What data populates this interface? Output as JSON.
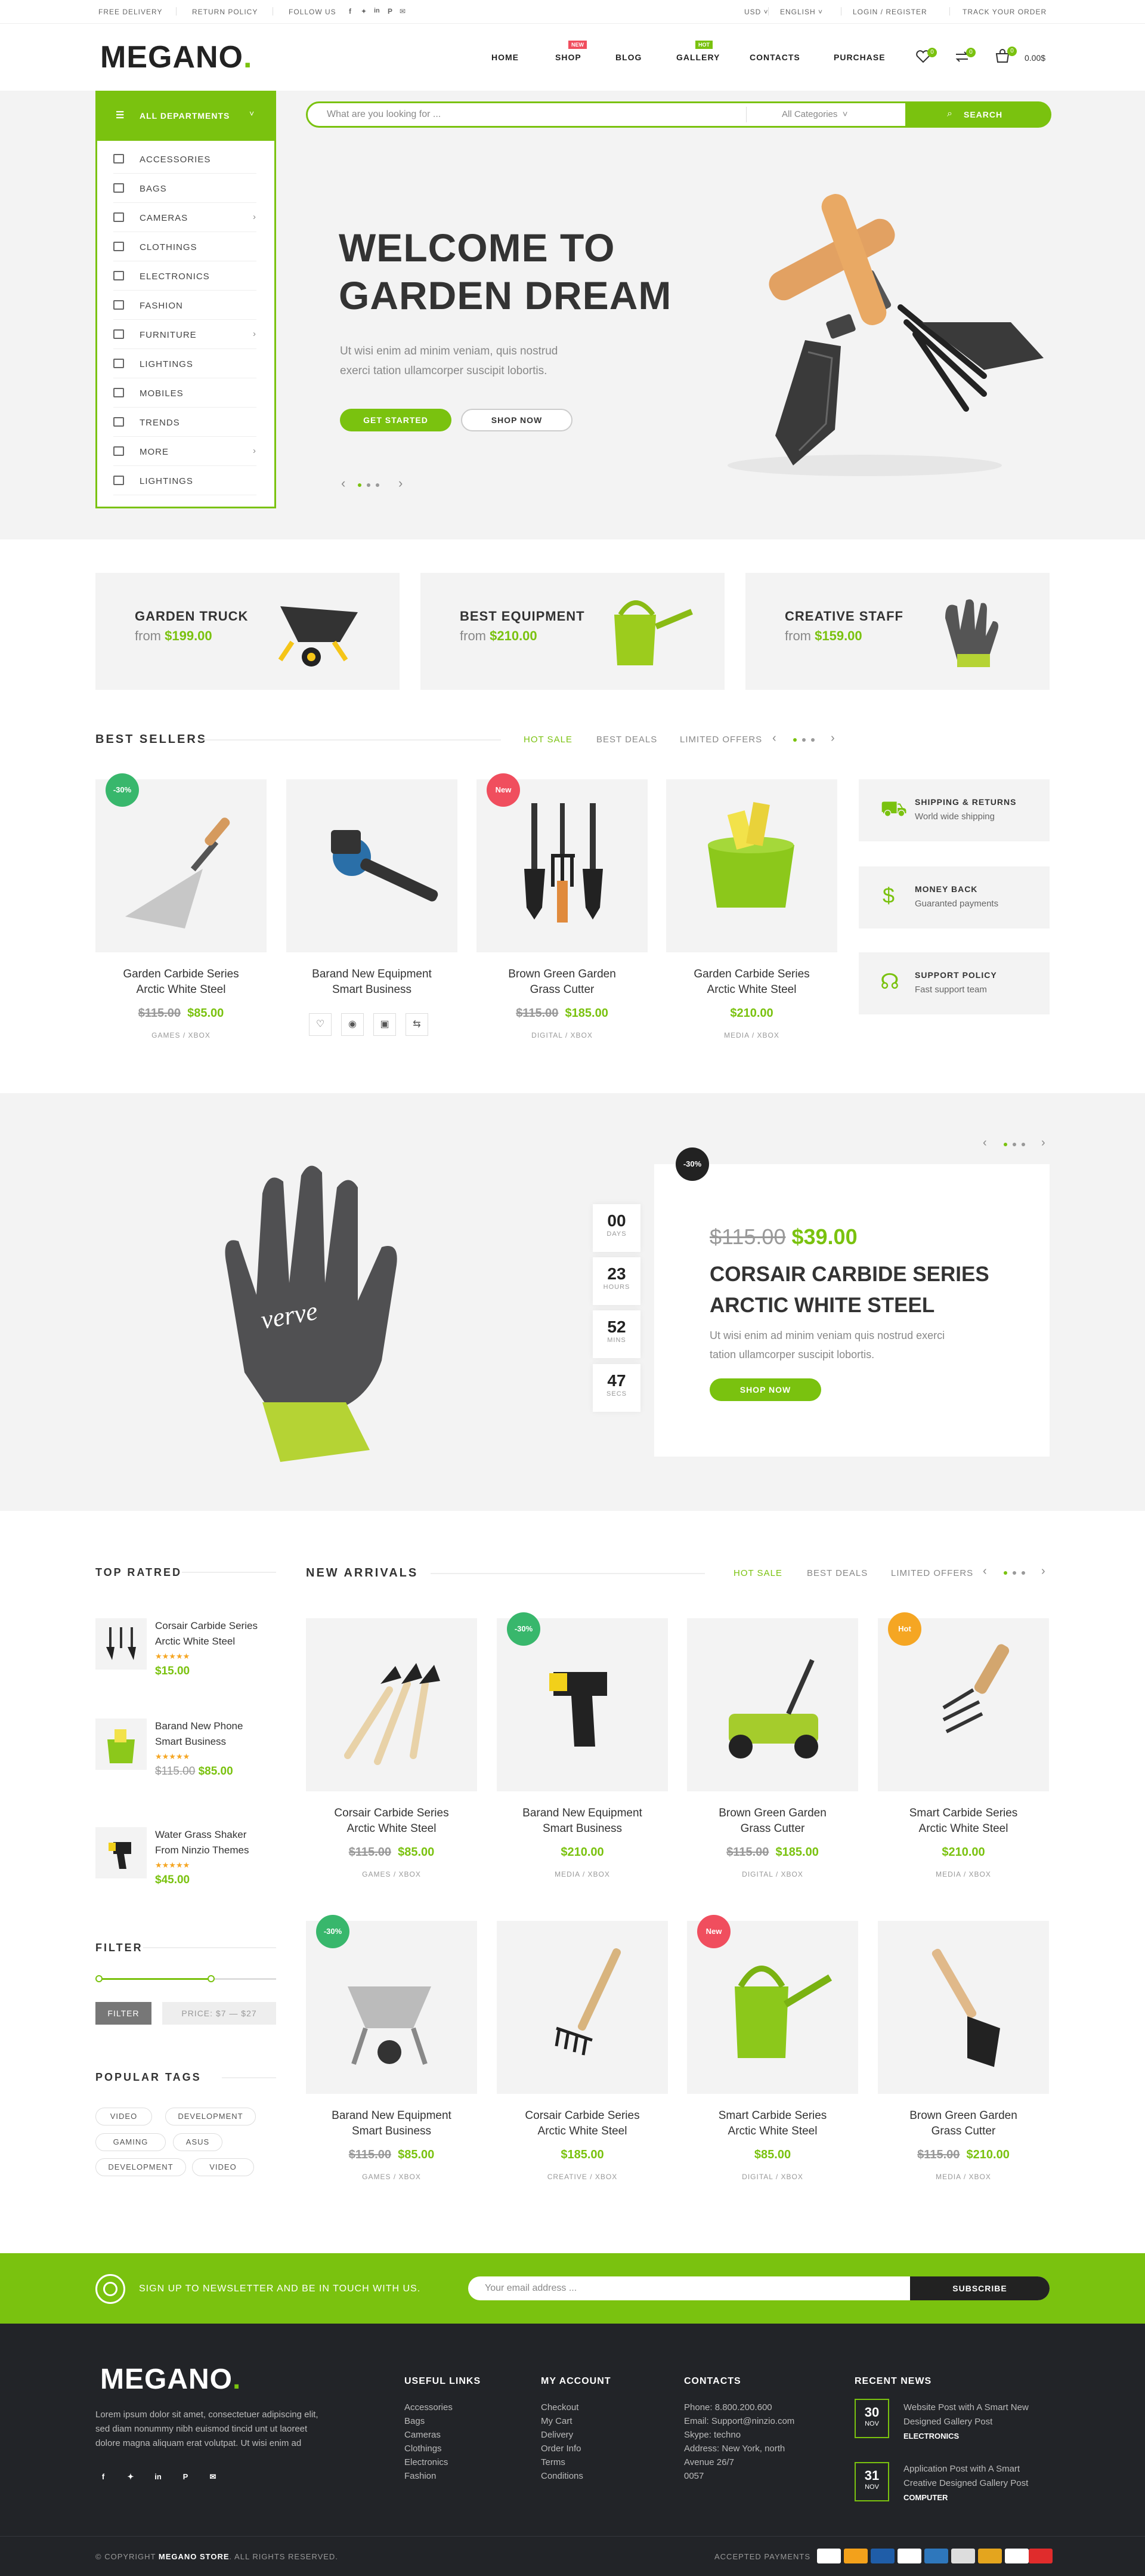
{
  "topbar": {
    "free_delivery": "Free Delivery",
    "return_policy": "Return Policy",
    "follow_us": "Follow Us",
    "currency": "USD",
    "language": "English",
    "login_register": "Login / Register",
    "track_order": "Track Your Order"
  },
  "header": {
    "logo": "MEGANO",
    "logo_dot": ".",
    "nav": [
      "Home",
      "Shop",
      "Blog",
      "Gallery",
      "Contacts",
      "Purchase"
    ],
    "shop_badge": "New",
    "gallery_badge": "Hot",
    "wishlist_count": "0",
    "compare_count": "0",
    "cart_count": "0",
    "cart_total": "0.00$"
  },
  "search": {
    "departments_label": "All Departments",
    "placeholder": "What are you looking for ...",
    "category_select": "All Categories",
    "button": "Search"
  },
  "categories": [
    {
      "label": "Accessories",
      "icon": "laptop-icon",
      "has_sub": false
    },
    {
      "label": "Bags",
      "icon": "bag-icon",
      "has_sub": false
    },
    {
      "label": "Cameras",
      "icon": "camera-icon",
      "has_sub": true
    },
    {
      "label": "Clothings",
      "icon": "shirt-icon",
      "has_sub": false
    },
    {
      "label": "Electronics",
      "icon": "monitor-icon",
      "has_sub": false
    },
    {
      "label": "Fashion",
      "icon": "headphones-icon",
      "has_sub": false
    },
    {
      "label": "Furniture",
      "icon": "sofa-icon",
      "has_sub": true
    },
    {
      "label": "Lightings",
      "icon": "tv-icon",
      "has_sub": false
    },
    {
      "label": "Mobiles",
      "icon": "mobile-icon",
      "has_sub": false
    },
    {
      "label": "Trends",
      "icon": "gamepad-icon",
      "has_sub": false
    },
    {
      "label": "More",
      "icon": "printer-icon",
      "has_sub": true
    },
    {
      "label": "Lightings",
      "icon": "tablet-icon",
      "has_sub": false
    }
  ],
  "hero": {
    "title_line1": "WELCOME TO",
    "title_line2": "GARDEN DREAM",
    "text_line1": "Ut wisi enim ad minim veniam, quis nostrud",
    "text_line2": "exerci tation ullamcorper suscipit lobortis.",
    "btn_primary": "Get Started",
    "btn_secondary": "Shop Now"
  },
  "promos": [
    {
      "title": "Garden Truck",
      "from": "from",
      "price": "$199.00"
    },
    {
      "title": "Best Equipment",
      "from": "from",
      "price": "$210.00"
    },
    {
      "title": "Creative Staff",
      "from": "from",
      "price": "$159.00"
    }
  ],
  "best_sellers": {
    "title": "Best Sellers",
    "tabs": [
      "Hot Sale",
      "Best Deals",
      "Limited Offers"
    ],
    "products": [
      {
        "name1": "Garden Carbide Series",
        "name2": "Arctic White Steel",
        "old": "$115.00",
        "price": "$85.00",
        "cat": "Games / Xbox",
        "badge": "-30%"
      },
      {
        "name1": "Barand New Equipment",
        "name2": "Smart Business",
        "old": "",
        "price": "",
        "cat": "",
        "badge": ""
      },
      {
        "name1": "Brown Green Garden",
        "name2": "Grass Cutter",
        "old": "$115.00",
        "price": "$185.00",
        "cat": "Digital / Xbox",
        "badge": "New"
      },
      {
        "name1": "Garden Carbide Series",
        "name2": "Arctic White Steel",
        "old": "",
        "price": "$210.00",
        "cat": "Media / Xbox",
        "badge": ""
      }
    ],
    "services": [
      {
        "title": "Shipping & Returns",
        "desc": "World wide shipping"
      },
      {
        "title": "Money Back",
        "desc": "Guaranted payments"
      },
      {
        "title": "Support Policy",
        "desc": "Fast support team"
      }
    ]
  },
  "deal": {
    "badge": "-30%",
    "old_price": "$115.00",
    "price": "$39.00",
    "title_line1": "CORSAIR CARBIDE SERIES",
    "title_line2": "ARCTIC WHITE STEEL",
    "text_line1": "Ut wisi enim ad minim veniam quis nostrud exerci",
    "text_line2": "tation ullamcorper suscipit lobortis.",
    "button": "Shop Now",
    "countdown": [
      {
        "value": "00",
        "label": "Days"
      },
      {
        "value": "23",
        "label": "Hours"
      },
      {
        "value": "52",
        "label": "Mins"
      },
      {
        "value": "47",
        "label": "Secs"
      }
    ]
  },
  "top_rated": {
    "title": "Top Ratred",
    "items": [
      {
        "name1": "Corsair Carbide Series",
        "name2": "Arctic White Steel",
        "old": "",
        "price": "$15.00"
      },
      {
        "name1": "Barand New Phone",
        "name2": "Smart Business",
        "old": "$115.00",
        "price": "$85.00"
      },
      {
        "name1": "Water Grass Shaker",
        "name2": "From Ninzio Themes",
        "old": "",
        "price": "$45.00"
      }
    ],
    "stars": "★★★★★"
  },
  "filter": {
    "title": "Filter",
    "button": "Filter",
    "price_label": "Price: $7 — $27"
  },
  "tags": {
    "title": "Popular Tags",
    "items": [
      "Video",
      "Development",
      "Gaming",
      "Asus",
      "Development",
      "Video"
    ]
  },
  "new_arrivals": {
    "title": "New Arrivals",
    "tabs": [
      "Hot Sale",
      "Best Deals",
      "Limited Offers"
    ],
    "products": [
      {
        "name1": "Corsair Carbide Series",
        "name2": "Arctic White Steel",
        "old": "$115.00",
        "price": "$85.00",
        "cat": "Games / Xbox",
        "badge": ""
      },
      {
        "name1": "Barand New Equipment",
        "name2": "Smart Business",
        "old": "",
        "price": "$210.00",
        "cat": "Media / Xbox",
        "badge": "-30%"
      },
      {
        "name1": "Brown Green Garden",
        "name2": "Grass Cutter",
        "old": "$115.00",
        "price": "$185.00",
        "cat": "Digital / Xbox",
        "badge": ""
      },
      {
        "name1": "Smart Carbide Series",
        "name2": "Arctic White Steel",
        "old": "",
        "price": "$210.00",
        "cat": "Media / Xbox",
        "badge": "Hot"
      },
      {
        "name1": "Barand New Equipment",
        "name2": "Smart Business",
        "old": "$115.00",
        "price": "$85.00",
        "cat": "Games / Xbox",
        "badge": "-30%"
      },
      {
        "name1": "Corsair Carbide Series",
        "name2": "Arctic White Steel",
        "old": "",
        "price": "$185.00",
        "cat": "Creative / Xbox",
        "badge": ""
      },
      {
        "name1": "Smart Carbide Series",
        "name2": "Arctic White Steel",
        "old": "",
        "price": "$85.00",
        "cat": "Digital / Xbox",
        "badge": "New"
      },
      {
        "name1": "Brown Green Garden",
        "name2": "Grass Cutter",
        "old": "$115.00",
        "price": "$210.00",
        "cat": "Media / Xbox",
        "badge": ""
      }
    ]
  },
  "newsletter": {
    "text": "Sign up to newsletter and be in touch with us.",
    "placeholder": "Your email address ...",
    "button": "Subscribe"
  },
  "footer": {
    "logo": "MEGANO",
    "about_line1": "Lorem ipsum dolor sit amet, consectetuer adipiscing elit,",
    "about_line2": "sed diam nonummy nibh euismod tincid unt ut laoreet",
    "about_line3": "dolore magna aliquam erat volutpat. Ut wisi enim ad",
    "useful_title": "Useful Links",
    "useful": [
      "Accessories",
      "Bags",
      "Cameras",
      "Clothings",
      "Electronics",
      "Fashion"
    ],
    "account_title": "My Account",
    "account": [
      "Checkout",
      "My Cart",
      "Delivery",
      "Order Info",
      "Terms",
      "Conditions"
    ],
    "contacts_title": "Contacts",
    "contacts": [
      "Phone: 8.800.200.600",
      "Email: Support@ninzio.com",
      "Skype: techno",
      "Address: New York, north",
      "Avenue 26/7",
      "0057"
    ],
    "news_title": "Recent News",
    "news": [
      {
        "day": "30",
        "month": "Nov",
        "line1": "Website Post with A Smart New",
        "line2": "Designed Gallery Post",
        "cat": "Electronics"
      },
      {
        "day": "31",
        "month": "Nov",
        "line1": "Application Post with A Smart",
        "line2": "Creative Designed Gallery Post",
        "cat": "Computer"
      }
    ],
    "copyright_prefix": "© Copyright",
    "copyright_store": "Megano Store",
    "copyright_suffix": ". All rights reserved.",
    "payments_label": "Accepted Payments"
  },
  "colors": {
    "accent": "#7ac20f",
    "red": "#f04e5e",
    "orange": "#f5a623",
    "dark": "#222428"
  }
}
